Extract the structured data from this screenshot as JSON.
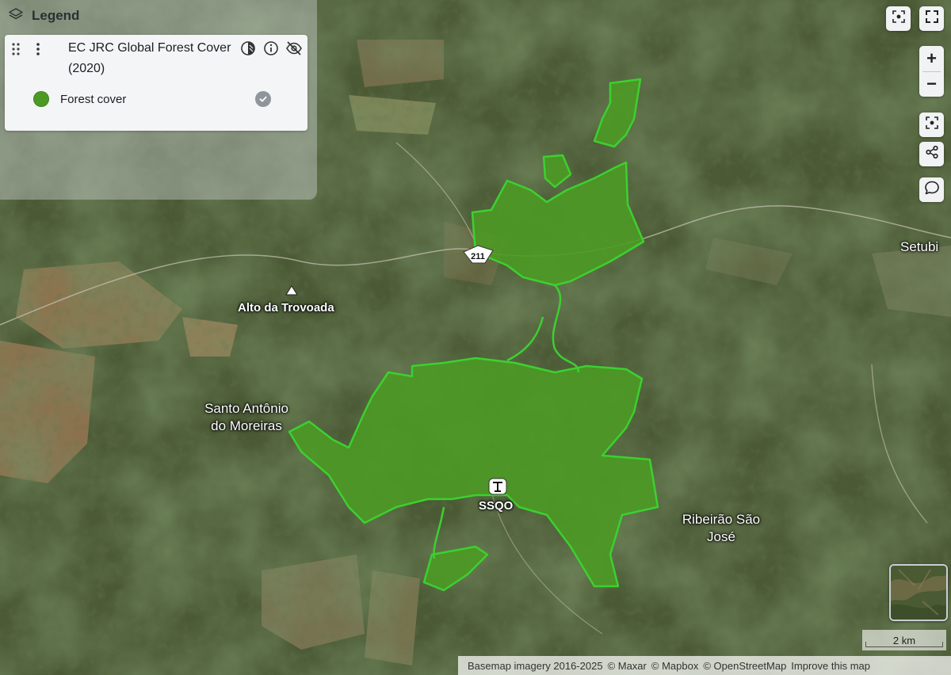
{
  "legend": {
    "title": "Legend",
    "layer_name": "EC JRC Global Forest Cover (2020)",
    "item_label": "Forest cover",
    "item_color": "#4c9a25",
    "icons": [
      "layers-icon",
      "drag-handle-icon",
      "kebab-menu-icon",
      "opacity-icon",
      "info-icon",
      "eye-off-icon",
      "check-circle-icon"
    ]
  },
  "controls": {
    "zoom_in": "+",
    "zoom_out": "−",
    "icons": [
      "locate-icon",
      "fullscreen-icon",
      "recenter-icon",
      "share-icon",
      "comment-icon"
    ]
  },
  "map": {
    "places": {
      "alto": "Alto da Trovoada",
      "santo": "Santo Antônio do Moreiras",
      "ribeirao": "Ribeirão São José",
      "setubi": "Setubi",
      "ssqo": "SSQO",
      "route": "211"
    },
    "forest_color": "#4c9a25",
    "outline_color": "#3bd12f"
  },
  "scale": {
    "label": "2 km"
  },
  "attribution": {
    "basemap": "Basemap imagery 2016-2025",
    "maxar": "© Maxar",
    "mapbox": "© Mapbox",
    "osm": "© OpenStreetMap",
    "improve": "Improve this map"
  }
}
